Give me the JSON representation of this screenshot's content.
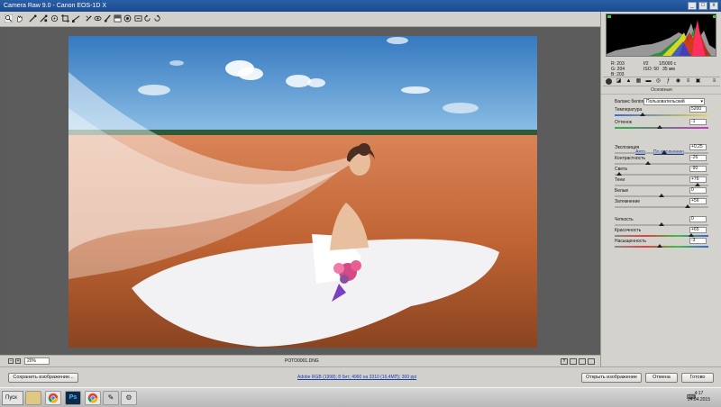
{
  "window": {
    "title": "Camera Raw 9.0 - Canon EOS-1D X"
  },
  "toolbar": {
    "tools": [
      "zoom-tool",
      "hand-tool",
      "white-balance-tool",
      "color-sampler-tool",
      "targeted-adjustment-tool",
      "crop-tool",
      "straighten-tool",
      "spot-removal-tool",
      "red-eye-tool",
      "adjustment-brush-tool",
      "graduated-filter-tool",
      "radial-filter-tool",
      "preferences-tool",
      "rotate-left-tool",
      "rotate-right-tool"
    ]
  },
  "sidebar": {
    "rgb": {
      "r": "R:  203",
      "g": "G:  204",
      "b": "B:  203"
    },
    "camera": {
      "aperture": "f/2",
      "shutter": "1/5000 c",
      "iso": "ISO: 50",
      "focal": "35 мм"
    },
    "panel_title": "Основные",
    "white_balance": {
      "label": "Баланс белого:",
      "value": "Пользовательский"
    },
    "auto_link": "Авто",
    "default_link": "По умолчанию",
    "sliders": [
      {
        "label": "Температура",
        "value": "5200",
        "pos": 0.3
      },
      {
        "label": "Оттенок",
        "value": "-1",
        "pos": 0.48
      },
      {
        "label": "Экспозиция",
        "value": "+0,25",
        "pos": 0.53
      },
      {
        "label": "Контрастность",
        "value": "-26",
        "pos": 0.36
      },
      {
        "label": "Света",
        "value": "-90",
        "pos": 0.05
      },
      {
        "label": "Тени",
        "value": "+76",
        "pos": 0.88
      },
      {
        "label": "Белые",
        "value": "0",
        "pos": 0.5
      },
      {
        "label": "Затемнение",
        "value": "+56",
        "pos": 0.78
      },
      {
        "label": "Четкость",
        "value": "0",
        "pos": 0.5
      },
      {
        "label": "Красочность",
        "value": "+65",
        "pos": 0.82
      },
      {
        "label": "Насыщенность",
        "value": "-3",
        "pos": 0.48
      }
    ]
  },
  "status": {
    "zoom": "20%",
    "filename": "POTO0001.DNG"
  },
  "bottom": {
    "save_label": "Сохранить изображение...",
    "workflow_link": "Adobe RGB (1998); 8 бит; 4960 на 3310 (16,4МП); 300 ppi",
    "open_label": "Открыть изображение",
    "cancel_label": "Отмена",
    "done_label": "Готово"
  },
  "taskbar": {
    "start_label": "Пуск",
    "time": "4:17",
    "date": "24.04.2015"
  },
  "colors": {
    "title_blue": "#1c4a8c",
    "sky": "#3d83c4",
    "field": "#c46a3a",
    "dress": "#f2f2f4"
  }
}
